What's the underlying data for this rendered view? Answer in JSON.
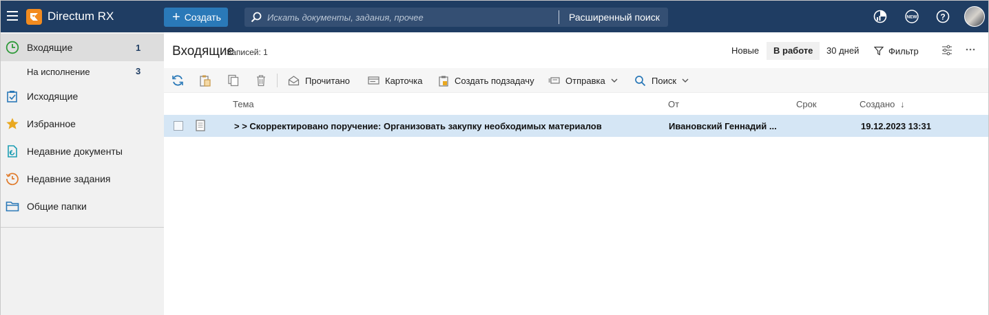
{
  "app": {
    "brand": "Directum RX",
    "create_label": "Создать"
  },
  "search": {
    "placeholder": "Искать документы, задания, прочее",
    "advanced_label": "Расширенный поиск"
  },
  "sidebar": {
    "items": [
      {
        "label": "Входящие",
        "count": "1",
        "icon": "clock-icon"
      },
      {
        "label": "На исполнение",
        "count": "3"
      },
      {
        "label": "Исходящие",
        "icon": "checklist-icon"
      },
      {
        "label": "Избранное",
        "icon": "star-icon"
      },
      {
        "label": "Недавние документы",
        "icon": "recent-document-icon"
      },
      {
        "label": "Недавние задания",
        "icon": "recent-task-icon"
      },
      {
        "label": "Общие папки",
        "icon": "folder-icon"
      }
    ]
  },
  "main": {
    "title": "Входящие",
    "records": "Записей: 1",
    "filters": [
      "Новые",
      "В работе",
      "30 дней"
    ],
    "filter_label": "Фильтр",
    "toolbar": {
      "read": "Прочитано",
      "card": "Карточка",
      "subtask": "Создать подзадачу",
      "send": "Отправка",
      "search": "Поиск"
    },
    "columns": {
      "subject": "Тема",
      "from": "От",
      "deadline": "Срок",
      "created": "Создано",
      "sort_arrow": "↓"
    },
    "rows": [
      {
        "subject": "> > Скорректировано поручение: Организовать закупку необходимых материалов",
        "from": "Ивановский Геннадий ...",
        "deadline": "",
        "created": "19.12.2023 13:31"
      }
    ]
  },
  "colors": {
    "topbar": "#1f3d63",
    "accent": "#2a79b8",
    "logo": "#f28b1f",
    "row_selected": "#d5e6f5"
  }
}
